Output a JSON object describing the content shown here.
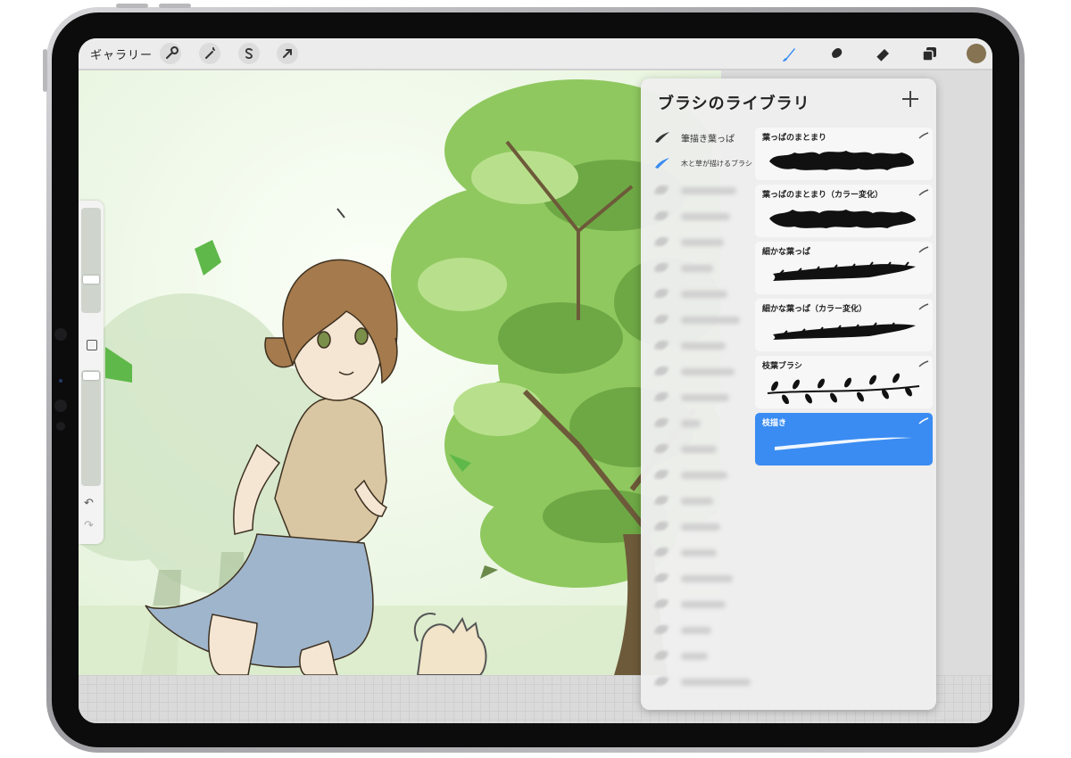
{
  "topbar": {
    "gallery_label": "ギャラリー",
    "left_tools": [
      "wrench-icon",
      "magic-wand-icon",
      "selection-icon",
      "arrow-icon"
    ],
    "right_tools": [
      "brush-icon",
      "smudge-icon",
      "eraser-icon",
      "layers-icon",
      "color-swatch"
    ],
    "active_tool": "brush-icon",
    "accent": "#3a8cf2",
    "current_color": "#857352"
  },
  "sidebar": {
    "size_slider_level": 0.46,
    "opacity_slider_level": 0.96
  },
  "brush_library": {
    "title": "ブラシのライブラリ",
    "categories": [
      {
        "label": "筆描き葉っぱ",
        "selected": false
      },
      {
        "label": "木と草が描けるブラシ",
        "selected": true
      }
    ],
    "brushes": [
      {
        "name": "葉っぱのまとまり",
        "selected": false
      },
      {
        "name": "葉っぱのまとまり（カラー変化）",
        "selected": false
      },
      {
        "name": "細かな葉っぱ",
        "selected": false
      },
      {
        "name": "細かな葉っぱ（カラー変化）",
        "selected": false
      },
      {
        "name": "枝葉ブラシ",
        "selected": false
      },
      {
        "name": "枝描き",
        "selected": true
      }
    ]
  }
}
